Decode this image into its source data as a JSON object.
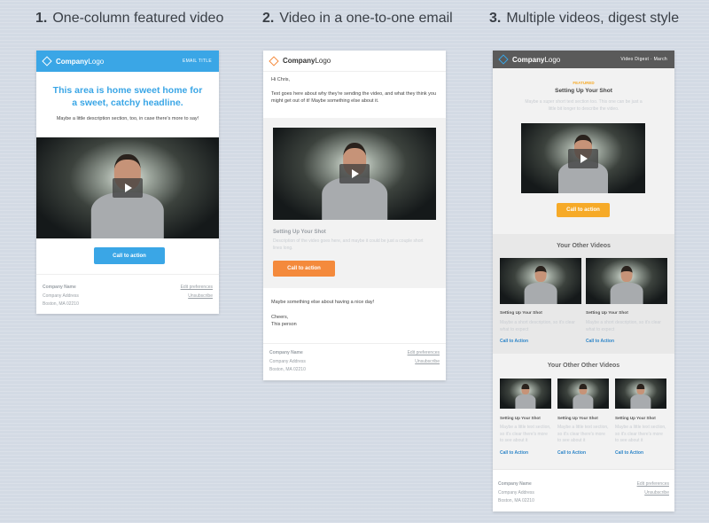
{
  "columns": [
    {
      "num": "1.",
      "title": "One-column featured video"
    },
    {
      "num": "2.",
      "title": "Video in a one-to-one email"
    },
    {
      "num": "3.",
      "title": "Multiple videos, digest style"
    }
  ],
  "colors": {
    "blue": "#3aa6e6",
    "orange": "#f48a3c",
    "amber": "#f6aa28",
    "dark_header": "#5a5a5a",
    "link": "#2f86c8"
  },
  "card1": {
    "logo_bold": "Company",
    "logo_light": "Logo",
    "header_right": "EMAIL TITLE",
    "headline": "This area is home sweet home for a sweet, catchy headline.",
    "description": "Maybe a little description section, too, in case there's more to say!",
    "cta": "Call to action",
    "footer_name": "Company Name",
    "footer_address1": "Company Address",
    "footer_address2": "Boston, MA 02210",
    "footer_link1": "Edit preferences",
    "footer_link2": "Unsubscribe"
  },
  "card2": {
    "logo_bold": "Company",
    "logo_light": "Logo",
    "greeting": "Hi Chris,",
    "intro": "Text goes here about why they're sending the video, and what they think you might get out of it! Maybe something else about it.",
    "video_title": "Setting Up Your Shot",
    "video_desc": "Description of the video goes here, and maybe it could be just a couple short lines long.",
    "cta": "Call to action",
    "closing": "Maybe something else about having a nice day!",
    "cheers": "Cheers,",
    "signature": "This person",
    "footer_name": "Company Name",
    "footer_address1": "Company Address",
    "footer_address2": "Boston, MA 02210",
    "footer_link1": "Edit preferences",
    "footer_link2": "Unsubscribe"
  },
  "card3": {
    "logo_bold": "Company",
    "logo_light": "Logo",
    "header_right": "Video Digest · March",
    "featured_label": "FEATURED",
    "featured_title": "Setting Up Your Shot",
    "featured_desc": "Maybe a super short text section too. This one can be just a little bit longer to describe the video.",
    "cta": "Call to action",
    "other_title": "Your Other Videos",
    "other_videos": [
      {
        "title": "Setting Up Your Shot",
        "desc": "Maybe a short description, so it's clear what to expect",
        "link": "Call to Action"
      },
      {
        "title": "Setting Up Your Shot",
        "desc": "Maybe a short description, so it's clear what to expect",
        "link": "Call to Action"
      }
    ],
    "other_other_title": "Your Other Other Videos",
    "other_other_videos": [
      {
        "title": "Setting Up Your Shot",
        "desc": "Maybe a little text section, so it's clear there's more to see about it",
        "link": "Call to Action"
      },
      {
        "title": "Setting Up Your Shot",
        "desc": "Maybe a little text section, so it's clear there's more to see about it",
        "link": "Call to Action"
      },
      {
        "title": "Setting Up Your Shot",
        "desc": "Maybe a little text section, so it's clear there's more to see about it",
        "link": "Call to Action"
      }
    ],
    "footer_name": "Company Name",
    "footer_address1": "Company Address",
    "footer_address2": "Boston, MA 02210",
    "footer_link1": "Edit preferences",
    "footer_link2": "Unsubscribe"
  }
}
